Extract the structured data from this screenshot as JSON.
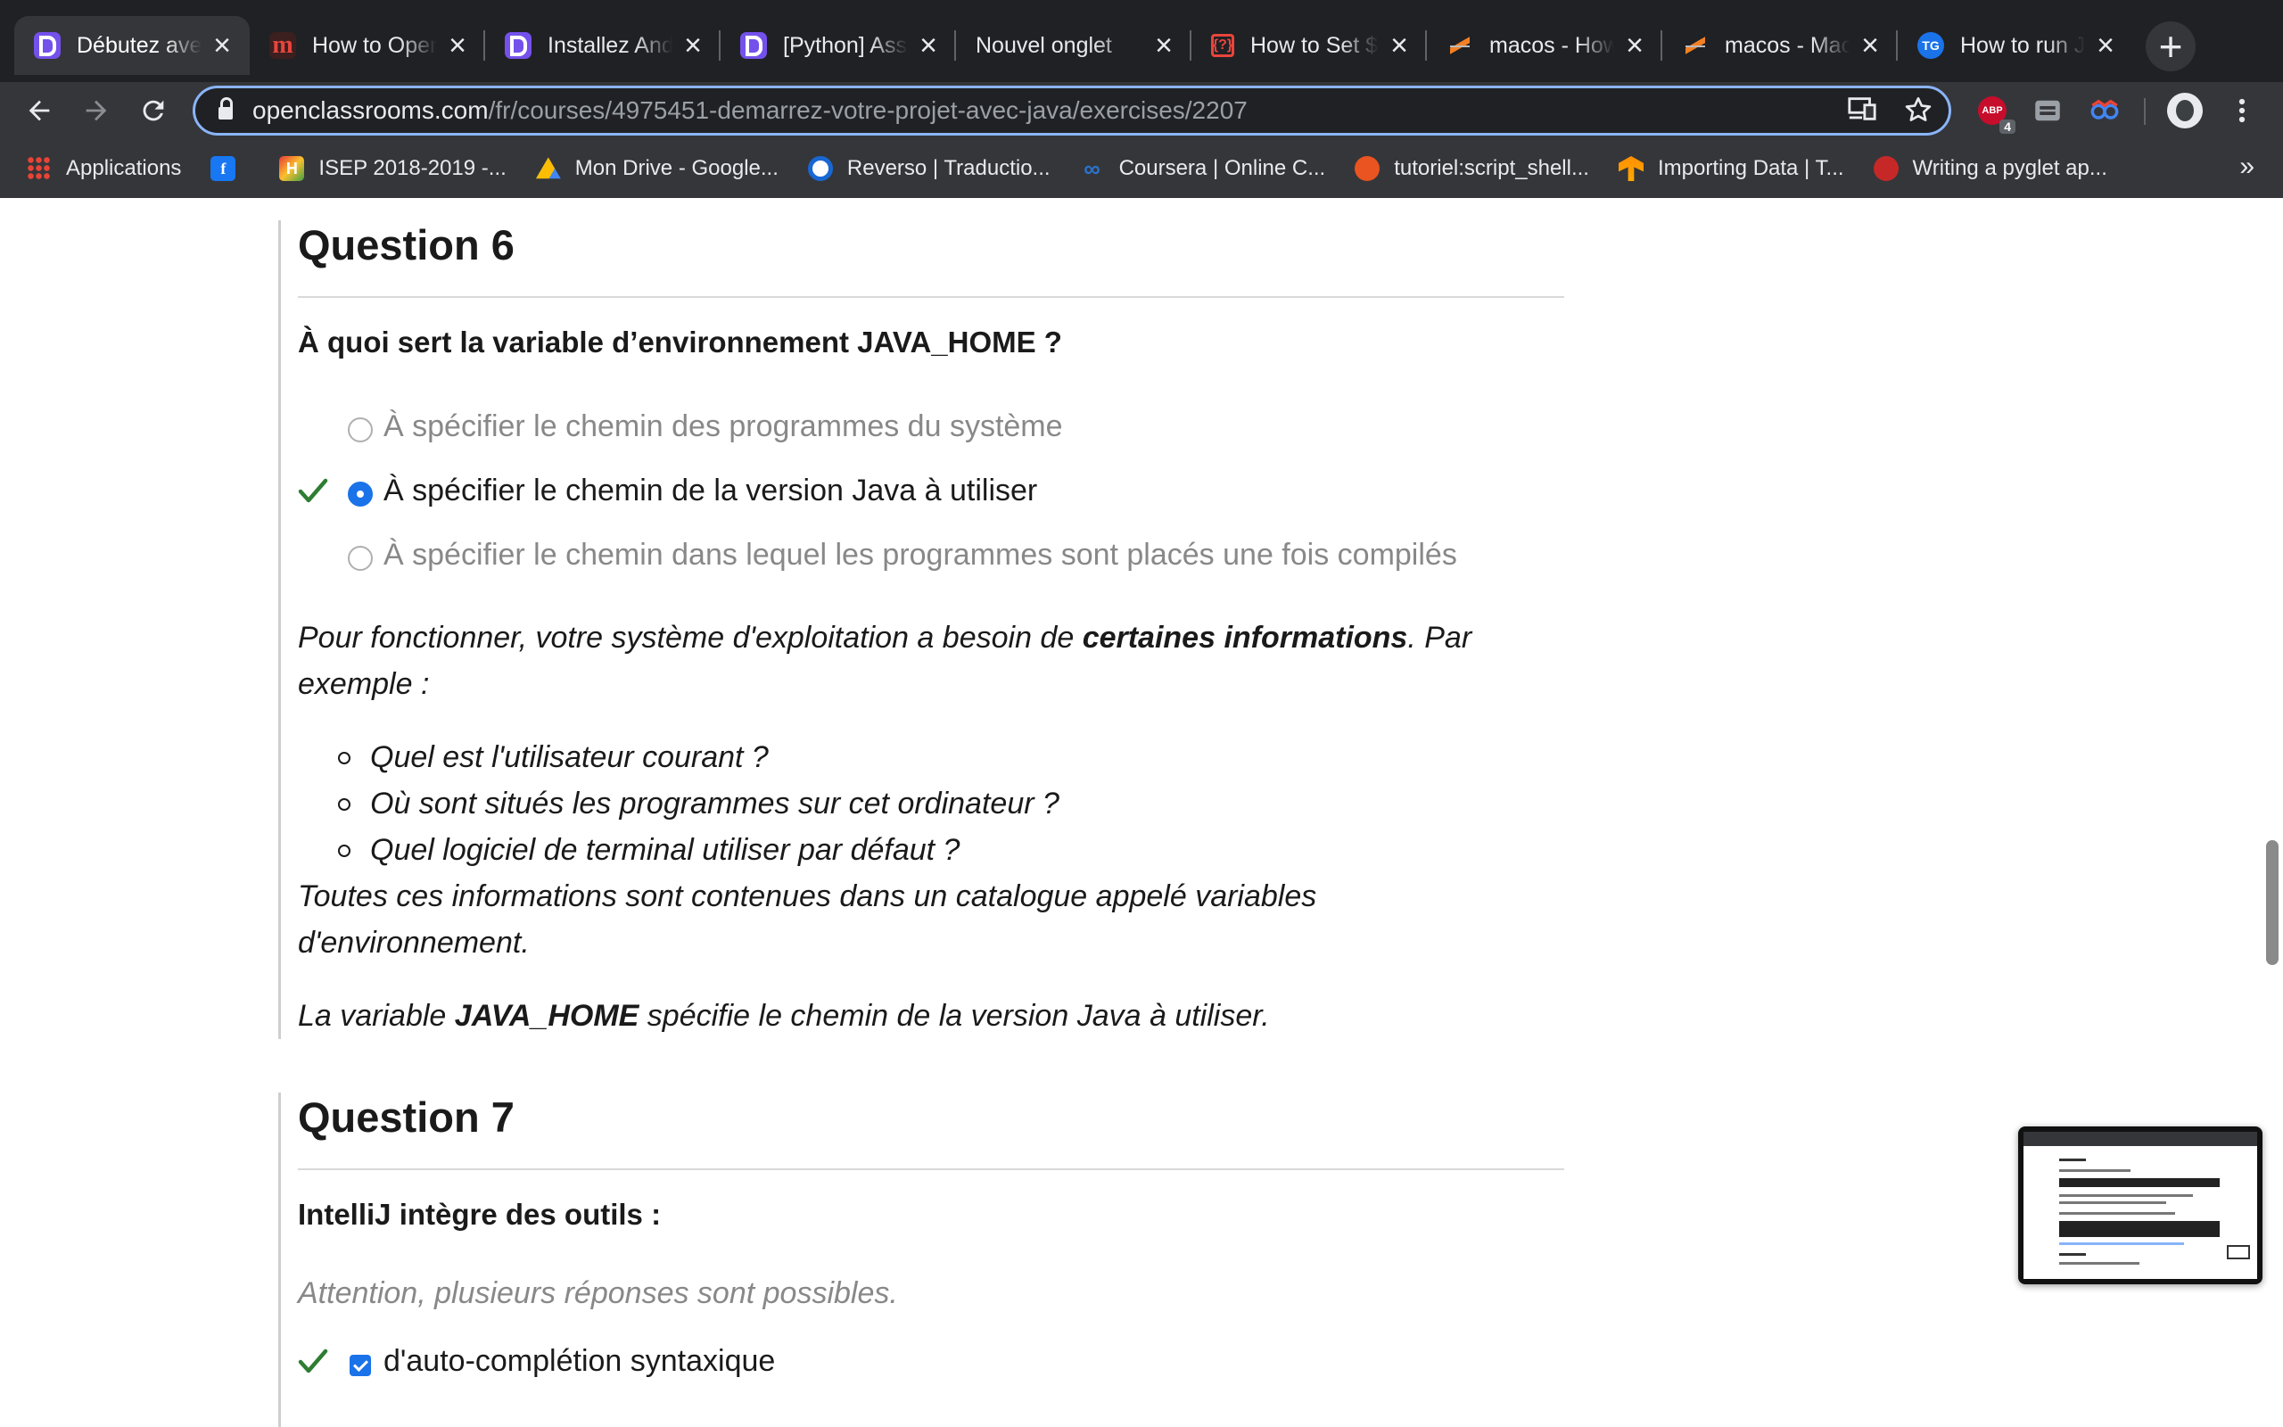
{
  "browser": {
    "tabs": [
      {
        "title": "Débutez avec",
        "favicon": "openclassrooms-icon",
        "active": true
      },
      {
        "title": "How to Open",
        "favicon": "m-icon",
        "active": false
      },
      {
        "title": "Installez Android",
        "favicon": "openclassrooms-icon",
        "active": false
      },
      {
        "title": "[Python] Assert",
        "favicon": "openclassrooms-icon",
        "active": false
      },
      {
        "title": "Nouvel onglet",
        "favicon": "none",
        "active": false
      },
      {
        "title": "How to Set $",
        "favicon": "code-icon",
        "active": false
      },
      {
        "title": "macos - How",
        "favicon": "stackoverflow-icon",
        "active": false
      },
      {
        "title": "macos - Mac",
        "favicon": "stackoverflow-icon",
        "active": false
      },
      {
        "title": "How to run J",
        "favicon": "tg-icon",
        "active": false
      }
    ],
    "tab_icon_text": {
      "m": "m",
      "code": "{?}",
      "tg": "TG"
    },
    "new_tab_label": "+",
    "close_label": "×",
    "url_host": "openclassrooms.com",
    "url_path": "/fr/courses/4975451-demarrez-votre-projet-avec-java/exercises/2207",
    "abp_label": "ABP",
    "abp_badge": "4",
    "bookmarks": [
      {
        "label": "Applications",
        "icon": "apps-grid-icon"
      },
      {
        "label": "",
        "icon": "facebook-icon",
        "glyph": "f"
      },
      {
        "label": "ISEP 2018-2019 -...",
        "icon": "isep-icon",
        "glyph": "H"
      },
      {
        "label": "Mon Drive - Google...",
        "icon": "google-drive-icon"
      },
      {
        "label": "Reverso | Traductio...",
        "icon": "reverso-icon"
      },
      {
        "label": "Coursera | Online C...",
        "icon": "coursera-icon",
        "glyph": "∞"
      },
      {
        "label": "tutoriel:script_shell...",
        "icon": "ubuntu-icon"
      },
      {
        "label": "Importing Data  |  T...",
        "icon": "tensorflow-icon"
      },
      {
        "label": "Writing a pyglet ap...",
        "icon": "pyglet-icon"
      }
    ],
    "bookmarks_more": "»"
  },
  "accent_color": "#1a73e8",
  "correct_color": "#2e7d32",
  "questions": {
    "q6": {
      "title": "Question 6",
      "prompt": "À quoi sert la variable d’environnement JAVA_HOME ?",
      "options": [
        {
          "label": "À spécifier le chemin des programmes du système",
          "selected": false,
          "correct": false
        },
        {
          "label": "À spécifier le chemin de la version Java à utiliser",
          "selected": true,
          "correct": true
        },
        {
          "label": "À spécifier le chemin dans lequel les programmes sont placés une fois compilés",
          "selected": false,
          "correct": false
        }
      ],
      "explanation": {
        "p1_start": "Pour fonctionner, votre système d'exploitation a besoin de ",
        "p1_bold": "certaines informations",
        "p1_end": ". Par exemple :",
        "bullets": [
          "Quel est l'utilisateur courant ?",
          "Où sont situés les programmes sur cet ordinateur ?",
          "Quel logiciel de terminal utiliser par défaut ?"
        ],
        "p2": "Toutes ces informations sont contenues dans un catalogue appelé variables d'environnement.",
        "p3_start": "La variable ",
        "p3_bold": "JAVA_HOME",
        "p3_end": " spécifie le chemin de la version Java à utiliser."
      }
    },
    "q7": {
      "title": "Question 7",
      "prompt": "IntelliJ intègre des outils :",
      "hint": "Attention, plusieurs réponses sont possibles.",
      "options": [
        {
          "label": "d'auto-complétion syntaxique",
          "selected": true,
          "correct": true
        }
      ]
    }
  }
}
